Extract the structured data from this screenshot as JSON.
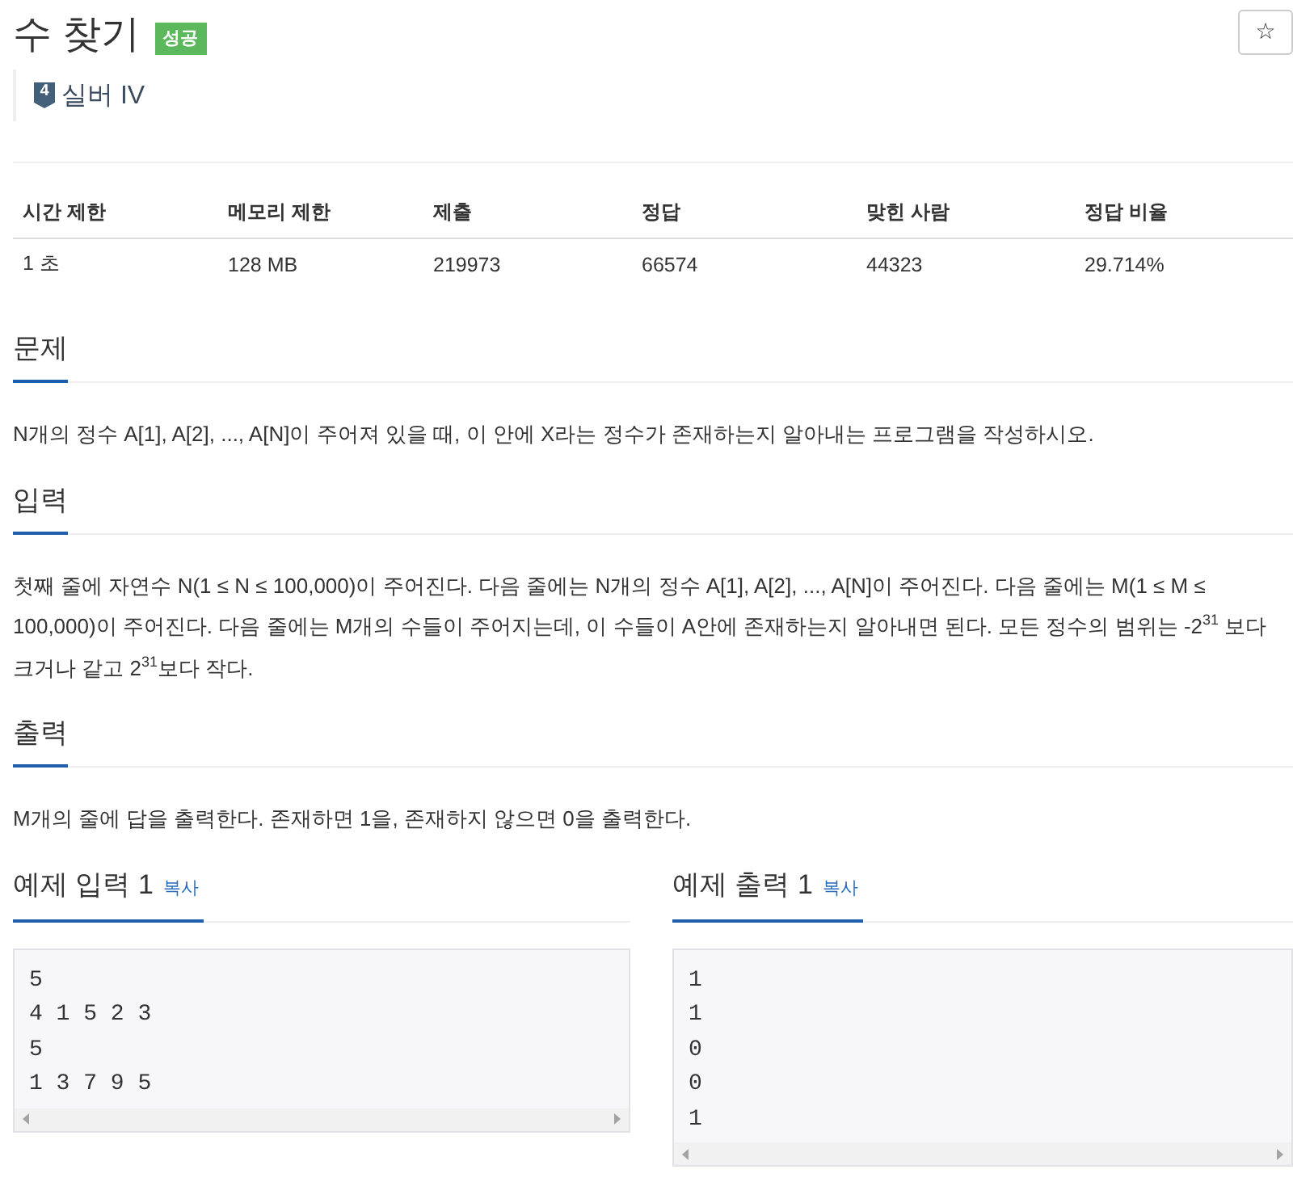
{
  "header": {
    "title": "수 찾기",
    "result_badge": "성공",
    "favorite_button": "☆"
  },
  "tier": {
    "badge_number": "4",
    "label": "실버 IV"
  },
  "stats_table": {
    "columns": [
      "시간 제한",
      "메모리 제한",
      "제출",
      "정답",
      "맞힌 사람",
      "정답 비율"
    ],
    "rows": [
      [
        "1 초",
        "128 MB",
        "219973",
        "66574",
        "44323",
        "29.714%"
      ]
    ]
  },
  "sections": [
    {
      "heading": "문제",
      "text": "N개의 정수 A[1], A[2], ..., A[N]이 주어져 있을 때, 이 안에 X라는 정수가 존재하는지 알아내는 프로그램을 작성하시오."
    },
    {
      "heading": "입력",
      "text": "첫째 줄에 자연수 N(1 ≤ N ≤ 100,000)이 주어진다. 다음 줄에는 N개의 정수 A[1], A[2], ..., A[N]이 주어진다. 다음 줄에는 M(1 ≤ M ≤ 100,000)이 주어진다. 다음 줄에는 M개의 수들이 주어지는데, 이 수들이 A안에 존재하는지 알아내면 된다. 모든 정수의 범위는 -2$^{31}$ 보다 크거나 같고 2$^{31}$보다 작다."
    },
    {
      "heading": "출력",
      "text": "M개의 줄에 답을 출력한다. 존재하면 1을, 존재하지 않으면 0을 출력한다."
    }
  ],
  "samples": [
    {
      "heading": "예제 입력 1",
      "copy_link": "복사",
      "text": "5\n4 1 5 2 3\n5\n1 3 7 9 5"
    },
    {
      "heading": "예제 출력 1",
      "copy_link": "복사",
      "text": "1\n1\n0\n0\n1"
    }
  ]
}
